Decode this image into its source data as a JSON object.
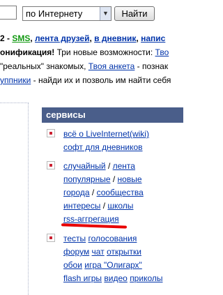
{
  "search": {
    "scope_selected": "по Интернету",
    "find_label": "Найти"
  },
  "news": {
    "line1": {
      "num": "2 - ",
      "sms": "SMS",
      "sep1": ", ",
      "friends": "лента друзей",
      "sep2": ", ",
      "diary": "в дневник",
      "sep3": ", ",
      "write": "напис"
    },
    "line2": {
      "bold": "онификация!",
      "rest": " Три новые возможности: ",
      "link": "Тво"
    },
    "line3": {
      "pre": " \"реальных\" знакомых, ",
      "link": "Твоя анкета",
      "post": " - познак"
    },
    "line4": {
      "link": "уппники",
      "post": " - найди их и позволь им найти себя"
    }
  },
  "services": {
    "title": "сервисы",
    "group1": {
      "about": "всё о LiveInternet(wiki)",
      "soft": "софт для дневников"
    },
    "group2": {
      "random": "случайный",
      "feed": "лента",
      "popular": "популярные",
      "new": "новые",
      "cities": "города",
      "communities": "сообщества",
      "interests": "интересы",
      "schools": "школы",
      "rss": "rss-аггрегация",
      "slash": "/"
    },
    "group3": {
      "tests": "тесты",
      "votes": "голосования",
      "forum": "форум",
      "chat": "чат",
      "cards": "открытки",
      "wallpapers": "обои",
      "game": "игра \"Олигарх\"",
      "flash": "flash игры",
      "video": "видео",
      "jokes": "приколы"
    }
  }
}
